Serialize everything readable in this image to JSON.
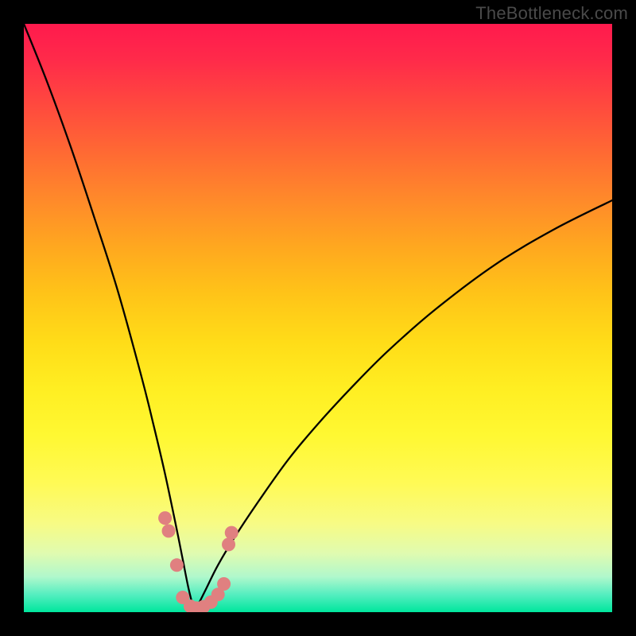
{
  "watermark": "TheBottleneck.com",
  "colors": {
    "curve": "#000000",
    "dots": "#e08080",
    "frame": "#000000"
  },
  "chart_data": {
    "type": "line",
    "title": "",
    "xlabel": "",
    "ylabel": "",
    "xlim": [
      0,
      100
    ],
    "ylim": [
      0,
      100
    ],
    "grid": false,
    "legend": false,
    "note": "V-shaped bottleneck curve on vertical color gradient (red→yellow→green). Minimum near x≈29. Curve rises steeply toward 100 on both sides. Right branch reaches ≈70 at x=100.",
    "series": [
      {
        "name": "left-branch",
        "x": [
          0,
          4,
          8,
          12,
          16,
          20,
          22,
          24,
          26,
          27,
          28,
          29
        ],
        "y": [
          100,
          90,
          79,
          67,
          54.5,
          40,
          32,
          23.5,
          14,
          9,
          4,
          0
        ]
      },
      {
        "name": "right-branch",
        "x": [
          29,
          31,
          33,
          36,
          40,
          45,
          50,
          56,
          62,
          70,
          80,
          90,
          100
        ],
        "y": [
          0,
          4,
          8,
          13,
          19,
          26,
          32,
          38.5,
          44.5,
          51.5,
          59,
          65,
          70
        ]
      }
    ],
    "points": [
      {
        "name": "left-dot-a",
        "x": 24.0,
        "y": 16.0
      },
      {
        "name": "left-dot-b",
        "x": 24.6,
        "y": 13.8
      },
      {
        "name": "left-dot-c",
        "x": 26.0,
        "y": 8.0
      },
      {
        "name": "floor-dot-1",
        "x": 27.0,
        "y": 2.5
      },
      {
        "name": "floor-dot-2",
        "x": 28.3,
        "y": 1.0
      },
      {
        "name": "floor-dot-3",
        "x": 29.3,
        "y": 0.7
      },
      {
        "name": "floor-dot-4",
        "x": 30.5,
        "y": 0.9
      },
      {
        "name": "floor-dot-5",
        "x": 31.8,
        "y": 1.7
      },
      {
        "name": "floor-dot-6",
        "x": 33.0,
        "y": 3.0
      },
      {
        "name": "floor-dot-7",
        "x": 34.0,
        "y": 4.8
      },
      {
        "name": "right-dot-a",
        "x": 34.8,
        "y": 11.5
      },
      {
        "name": "right-dot-b",
        "x": 35.3,
        "y": 13.5
      }
    ]
  }
}
